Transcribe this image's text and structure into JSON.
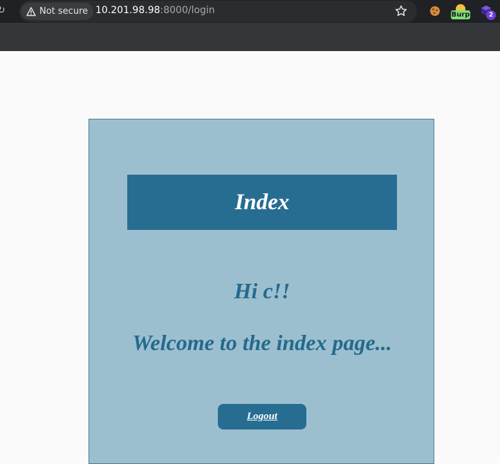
{
  "browser": {
    "security_label": "Not secure",
    "url_host": "10.201.98.98",
    "url_rest": ":8000/login",
    "extensions": {
      "burp_label": "Burp",
      "badge_count": "2"
    },
    "icons": [
      "reload-icon",
      "warning-icon",
      "bookmark-star-icon",
      "cookie-extension-icon",
      "burp-extension-icon",
      "cube-extension-icon"
    ]
  },
  "page": {
    "header_title": "Index",
    "greeting": "Hi c!!",
    "welcome": "Welcome to the index page...",
    "logout_label": "Logout"
  },
  "colors": {
    "card_background": "#9cbfcf",
    "accent": "#266d91",
    "heading_text": "#246a8c"
  }
}
